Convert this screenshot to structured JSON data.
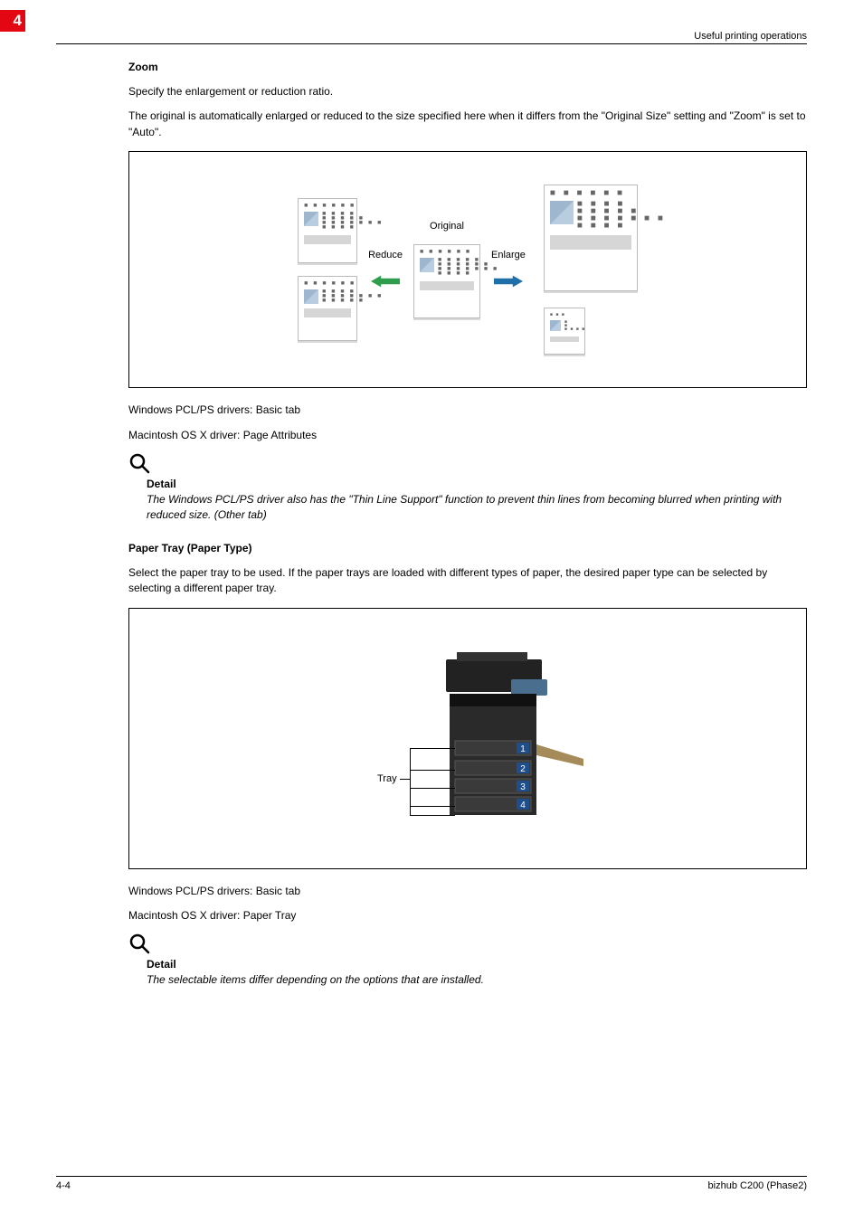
{
  "chapter_number": "4",
  "header_text": "Useful printing operations",
  "zoom": {
    "title": "Zoom",
    "para1": "Specify the enlargement or reduction ratio.",
    "para2": "The original is automatically enlarged or reduced to the size specified here when it differs from the \"Original Size\" setting and \"Zoom\" is set to \"Auto\".",
    "labels": {
      "original": "Original",
      "reduce": "Reduce",
      "enlarge": "Enlarge"
    },
    "driver1": "Windows PCL/PS drivers: Basic tab",
    "driver2": "Macintosh OS X driver: Page Attributes",
    "detail_label": "Detail",
    "detail_text": "The Windows PCL/PS driver also has the \"Thin Line Support\" function to prevent thin lines from becoming blurred when printing with reduced size. (Other tab)"
  },
  "papertray": {
    "title": "Paper Tray (Paper Type)",
    "para": "Select the paper tray to be used. If the paper trays are loaded with different types of paper, the desired paper type can be selected by selecting a different paper tray.",
    "tray_label": "Tray",
    "tray_nums": [
      "1",
      "2",
      "3",
      "4"
    ],
    "driver1": "Windows PCL/PS drivers: Basic tab",
    "driver2": "Macintosh OS X driver: Paper Tray",
    "detail_label": "Detail",
    "detail_text": "The selectable items differ depending on the options that are installed."
  },
  "footer": {
    "left": "4-4",
    "right": "bizhub C200 (Phase2)"
  }
}
